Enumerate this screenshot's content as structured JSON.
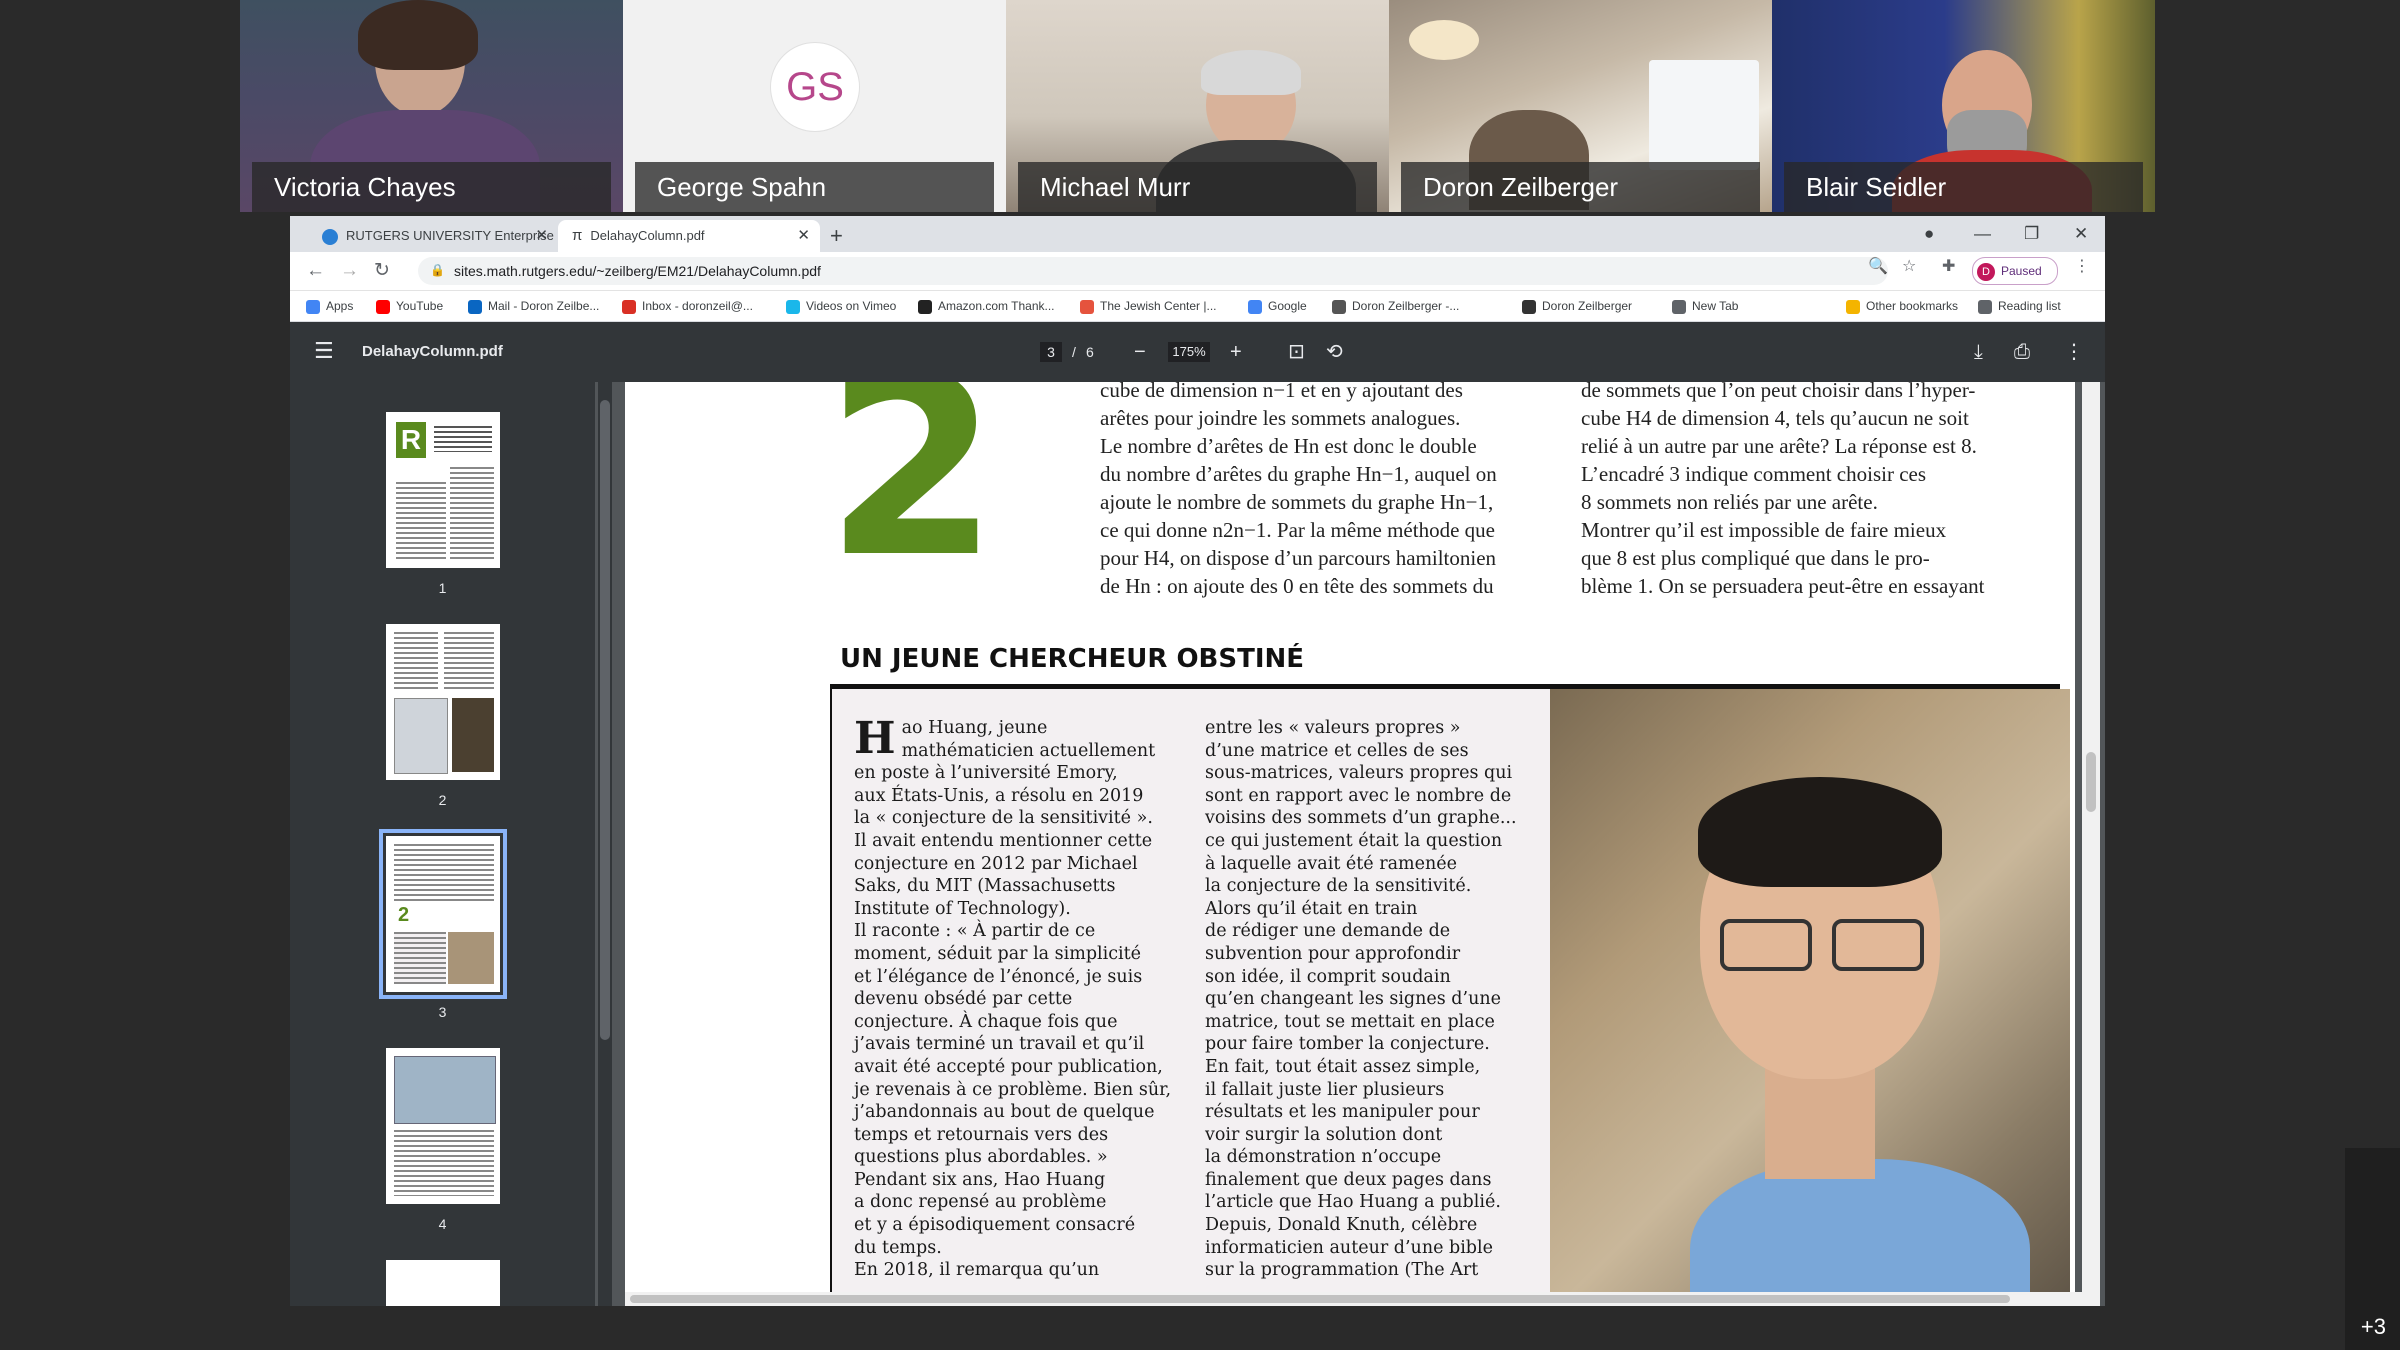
{
  "participants": [
    {
      "name": "Victoria Chayes"
    },
    {
      "name": "George Spahn",
      "initials": "GS"
    },
    {
      "name": "Michael Murr"
    },
    {
      "name": "Doron Zeilberger"
    },
    {
      "name": "Blair Seidler"
    }
  ],
  "more_participants": "+3",
  "browser": {
    "tabs": [
      {
        "label": "RUTGERS UNIVERSITY Enterprise",
        "active": false
      },
      {
        "label": "DelahayColumn.pdf",
        "active": true
      }
    ],
    "url": "sites.math.rutgers.edu/~zeilberg/EM21/DelahayColumn.pdf",
    "profile_initial": "D",
    "profile_status": "Paused",
    "bookmarks": [
      {
        "label": "Apps",
        "color": "#4285f4"
      },
      {
        "label": "YouTube",
        "color": "#ff0000"
      },
      {
        "label": "Mail - Doron Zeilbe...",
        "color": "#0a66c2"
      },
      {
        "label": "Inbox - doronzeil@...",
        "color": "#d93025"
      },
      {
        "label": "Videos on Vimeo",
        "color": "#1ab7ea"
      },
      {
        "label": "Amazon.com Thank...",
        "color": "#222222"
      },
      {
        "label": "The Jewish Center |...",
        "color": "#e5533d"
      },
      {
        "label": "Google",
        "color": "#4285f4"
      },
      {
        "label": "Doron Zeilberger -...",
        "color": "#555555"
      },
      {
        "label": "Doron Zeilberger",
        "color": "#333333"
      },
      {
        "label": "New Tab",
        "color": "#5f6368"
      },
      {
        "label": "Other bookmarks",
        "color": "#f4b400"
      },
      {
        "label": "Reading list",
        "color": "#5f6368"
      }
    ]
  },
  "pdf": {
    "filename": "DelahayColumn.pdf",
    "current_page": "3",
    "total_pages": "6",
    "zoom": "175%",
    "thumbnails": [
      "1",
      "2",
      "3",
      "4"
    ],
    "selected_thumbnail": "3",
    "section_number": "2",
    "section_heading": "UN JEUNE CHERCHEUR OBSTINÉ",
    "top_col1": [
      "cube de dimension n−1 et en y ajoutant des",
      "arêtes pour joindre les sommets analogues.",
      "Le nombre d’arêtes de Hn est donc le double",
      "du nombre d’arêtes du graphe Hn−1, auquel on",
      "ajoute le nombre de sommets du graphe Hn−1,",
      "ce qui donne n2n−1. Par la même méthode que",
      "pour H4, on dispose d’un parcours hamiltonien",
      "de Hn : on ajoute des 0 en tête des sommets du"
    ],
    "top_col2": [
      "de sommets que l’on peut choisir dans l’hyper-",
      "cube H4 de dimension 4, tels qu’aucun ne soit",
      "relié à un autre par une arête? La réponse est 8.",
      "L’encadré 3 indique comment choisir ces",
      "8 sommets non reliés par une arête.",
      "Montrer qu’il est impossible de faire mieux",
      "que 8 est plus compliqué que dans le pro-",
      "blème 1. On se persuadera peut-être en essayant"
    ],
    "box_col1_dropcap": "H",
    "box_col1": [
      "ao Huang, jeune",
      "mathématicien actuellement",
      "en poste à l’université Emory,",
      "aux États-Unis, a résolu en 2019",
      "la « conjecture de la sensitivité ».",
      "Il avait entendu mentionner cette",
      "conjecture en 2012 par Michael",
      "Saks, du MIT (Massachusetts",
      "Institute of Technology).",
      "Il raconte : « À partir de ce",
      "moment, séduit par la simplicité",
      "et l’élégance de l’énoncé, je suis",
      "devenu obsédé par cette",
      "conjecture. À chaque fois que",
      "j’avais terminé un travail et qu’il",
      "avait été accepté pour publication,",
      "je revenais à ce problème. Bien sûr,",
      "j’abandonnais au bout de quelque",
      "temps et retournais vers des",
      "questions plus abordables. »",
      "Pendant six ans, Hao Huang",
      "a donc repensé au problème",
      "et y a épisodiquement consacré",
      " du temps.",
      "En 2018, il remarqua qu’un"
    ],
    "box_col2": [
      "entre les « valeurs propres »",
      "d’une matrice et celles de ses",
      "sous-matrices, valeurs propres qui",
      "sont en rapport avec le nombre de",
      "voisins des sommets d’un graphe...",
      "ce qui justement était la question",
      "à laquelle avait été ramenée",
      "la conjecture de la sensitivité.",
      "Alors qu’il était en train",
      "de rédiger une demande de",
      "subvention pour approfondir",
      "son idée, il comprit soudain",
      "qu’en changeant les signes d’une",
      "matrice, tout se mettait en place",
      "pour faire tomber la conjecture.",
      "En fait, tout était assez simple,",
      "il fallait juste lier plusieurs",
      "résultats et les manipuler pour",
      "voir surgir la solution dont",
      "la démonstration n’occupe",
      "finalement que deux pages dans",
      "l’article que Hao Huang a publié.",
      "Depuis, Donald Knuth, célèbre",
      "informaticien auteur d’une bible",
      "sur la programmation (The Art"
    ]
  },
  "colors": {
    "section_green": "#5a8a1e",
    "pdf_toolbar": "#323639",
    "selected_thumbnail_outline": "#8ab4f8"
  }
}
